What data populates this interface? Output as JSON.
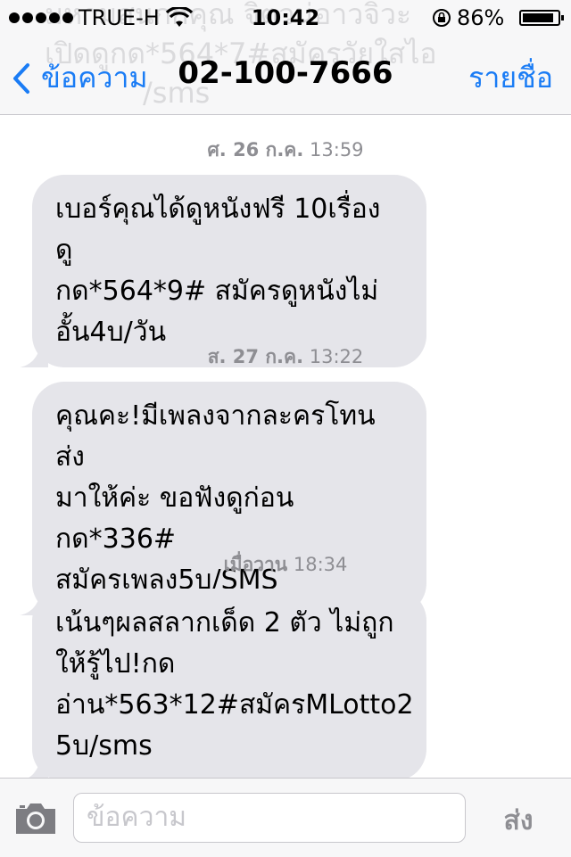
{
  "status_bar": {
    "carrier": "TRUE-H",
    "time": "10:42",
    "battery": "86%",
    "battery_level": 0.86
  },
  "background_text": [
    "มหามสนกกคุณ จิตวน่อาวจิวะ",
    "เปิดดูกด*564*7#สมัครวัยใสไอ",
    "/sms"
  ],
  "nav": {
    "back_label": "ข้อความ",
    "title": "02-100-7666",
    "contacts_label": "รายชื่อ"
  },
  "messages": [
    {
      "day": "ศ. 26 ก.ค.",
      "time": "13:59",
      "lines": [
        "เบอร์คุณได้ดูหนังฟรี 10เรื่อง ดู",
        "กด*564*9# สมัครดูหนังไม่",
        "อั้น4บ/วัน"
      ]
    },
    {
      "day": "ส. 27 ก.ค.",
      "time": "13:22",
      "lines": [
        "คุณคะ!มีเพลงจากละครโทนส่ง",
        "มาให้ค่ะ ขอฟังดูก่อนกด*336#",
        "สมัครเพลง5บ/SMS"
      ]
    },
    {
      "day": "เมื่อวาน",
      "time": "18:34",
      "lines": [
        "เน้นๆผลสลากเด็ด 2 ตัว ไม่ถูก",
        "ให้รู้ไป!กด",
        "อ่าน*563*12#สมัครMLotto2",
        "5บ/sms"
      ]
    }
  ],
  "input": {
    "placeholder": "ข้อความ",
    "send_label": "ส่ง"
  },
  "colors": {
    "accent": "#1a7cf5",
    "bubble": "#e5e5ea",
    "timestamp": "#8e8e93"
  },
  "icons": [
    "signal-dots-icon",
    "wifi-icon",
    "rotation-lock-icon",
    "battery-icon",
    "chevron-left-icon",
    "camera-icon"
  ]
}
